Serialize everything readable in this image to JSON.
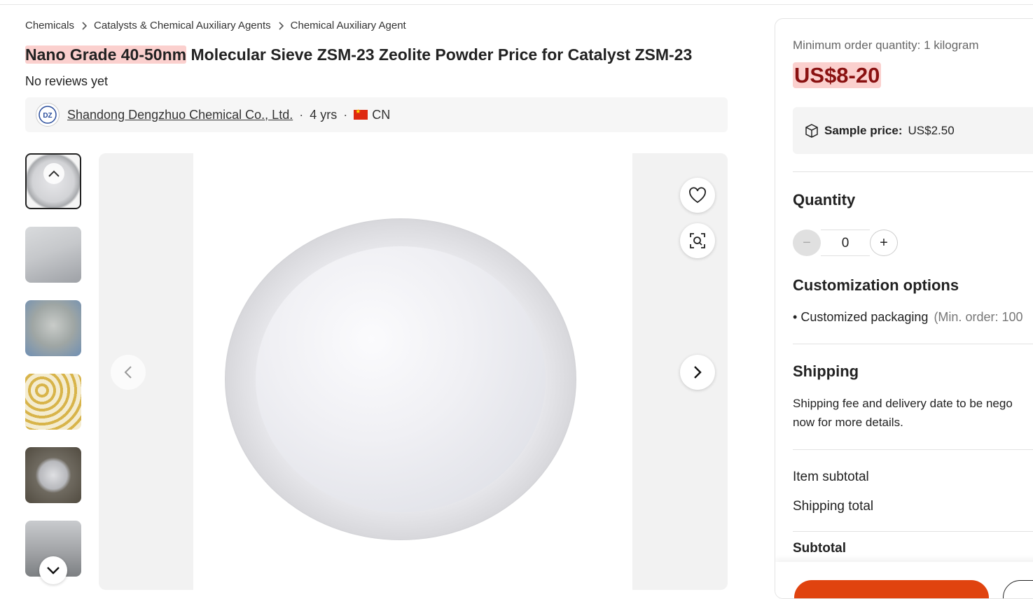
{
  "breadcrumb": {
    "items": [
      "Chemicals",
      "Catalysts & Chemical Auxiliary Agents",
      "Chemical Auxiliary Agent"
    ]
  },
  "product": {
    "title_highlight": "Nano Grade 40-50nm",
    "title_rest": " Molecular Sieve ZSM-23 Zeolite Powder Price for Catalyst ZSM-23",
    "reviews": "No reviews yet"
  },
  "supplier": {
    "logo_text": "DZ",
    "name": "Shandong Dengzhuo Chemical Co., Ltd.",
    "years": "4 yrs",
    "country": "CN"
  },
  "gallery": {
    "thumbnail_count": 6,
    "active_index": 0
  },
  "order": {
    "moq": "Minimum order quantity: 1 kilogram",
    "price": "US$8-20",
    "sample_label": "Sample price:",
    "sample_price": "US$2.50",
    "quantity_heading": "Quantity",
    "quantity_minus": "−",
    "quantity_value": "0",
    "quantity_plus": "+",
    "custom_heading": "Customization options",
    "custom_item": "Customized packaging",
    "custom_min": "(Min. order: 100",
    "shipping_heading": "Shipping",
    "shipping_line1": "Shipping fee and delivery date to be nego",
    "shipping_line2": "now for more details.",
    "item_subtotal": "Item subtotal",
    "shipping_total": "Shipping total",
    "subtotal": "Subtotal"
  },
  "colors": {
    "price_text": "#8a1111",
    "highlight_bg": "#fbd0ce",
    "cta": "#e0430f"
  }
}
